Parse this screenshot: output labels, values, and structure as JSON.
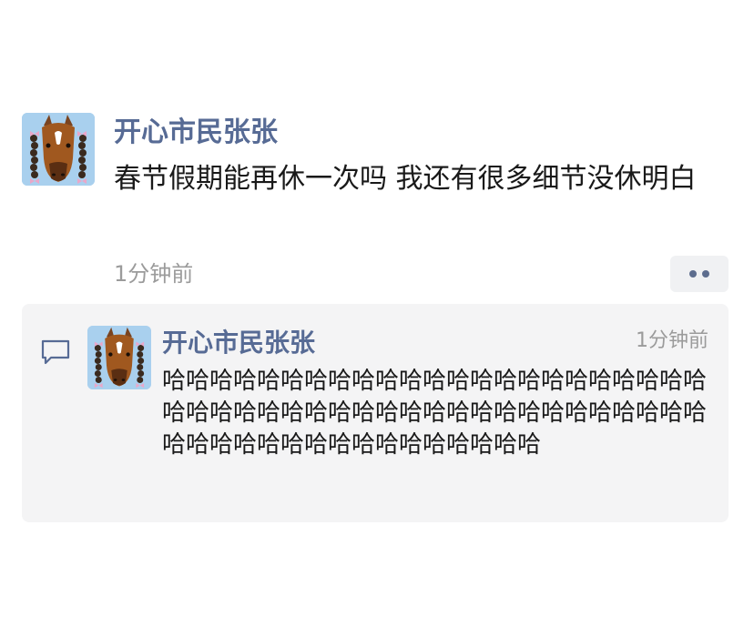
{
  "post": {
    "author": "开心市民张张",
    "text": "春节假期能再休一次吗 我还有很多细节没休明白",
    "time": "1分钟前",
    "more_icon": "more-dots-icon",
    "avatar_icon": "horse-avatar"
  },
  "comment": {
    "icon": "comment-bubble-icon",
    "author": "开心市民张张",
    "time": "1分钟前",
    "text": "哈哈哈哈哈哈哈哈哈哈哈哈哈哈哈哈哈哈哈哈哈哈哈哈哈哈哈哈哈哈哈哈哈哈哈哈哈哈哈哈哈哈哈哈哈哈哈哈哈哈哈哈哈哈哈哈哈哈哈哈哈哈",
    "avatar_icon": "horse-avatar"
  },
  "colors": {
    "name_link": "#576b95",
    "text": "#191919",
    "muted": "#9b9b9b",
    "panel_bg": "#f4f4f5"
  }
}
